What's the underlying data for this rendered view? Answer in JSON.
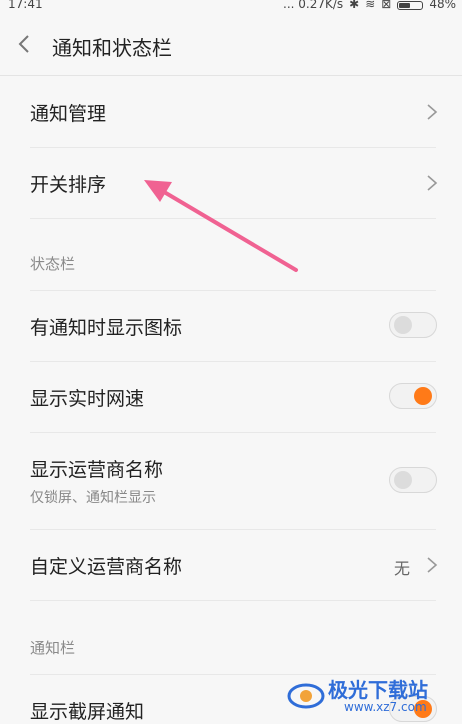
{
  "status_bar": {
    "time": "17:41",
    "network_speed": "... 0.27K/s",
    "battery": "48%"
  },
  "header": {
    "title": "通知和状态栏"
  },
  "rows": {
    "notification_management": "通知管理",
    "switch_order": "开关排序",
    "show_icon_on_notification": "有通知时显示图标",
    "show_realtime_speed": "显示实时网速",
    "show_carrier_name": "显示运营商名称",
    "show_carrier_name_sub": "仅锁屏、通知栏显示",
    "custom_carrier_name": "自定义运营商名称",
    "custom_carrier_value": "无",
    "show_screenshot_notification": "显示截屏通知"
  },
  "sections": {
    "status_bar": "状态栏",
    "notification_bar": "通知栏"
  },
  "toggles": {
    "show_icon_on_notification": false,
    "show_realtime_speed": true,
    "show_carrier_name": false,
    "show_screenshot_notification": true
  },
  "colors": {
    "accent": "#ff7a18",
    "annotation_arrow": "#f06292",
    "watermark": "#2f6dd8"
  },
  "watermark": {
    "title": "极光下载站",
    "url": "www.xz7.com"
  }
}
